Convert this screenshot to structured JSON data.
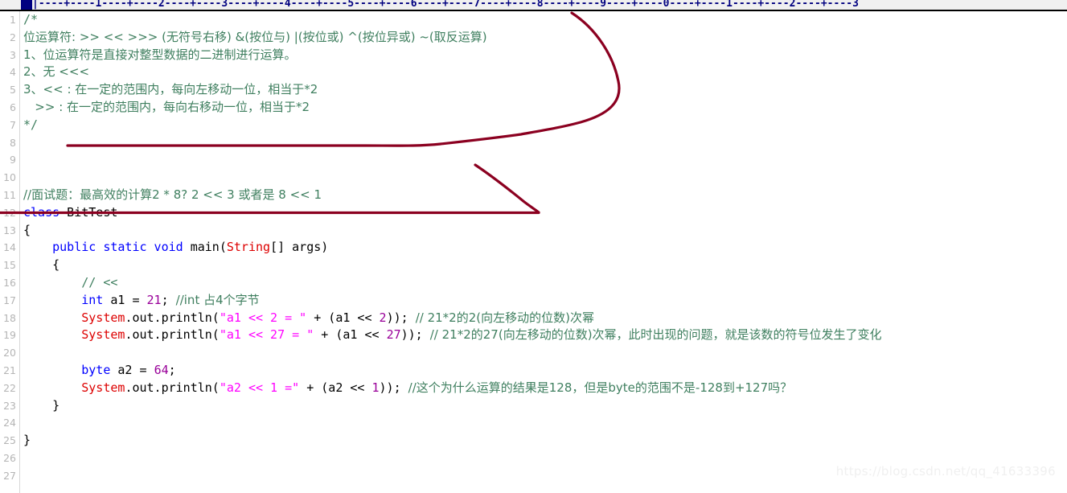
{
  "ruler": {
    "name": "column-ruler",
    "marks": "|----+----1----+----2----+----3----+----4----+----5----+----6----+----7----+----8----+----9----+----0----+----1----+----2----+----3",
    "caret_column": 1,
    "color": "#000080"
  },
  "gutter": {
    "line_numbers": [
      1,
      2,
      3,
      4,
      5,
      6,
      7,
      8,
      9,
      10,
      11,
      12,
      13,
      14,
      15,
      16,
      17,
      18,
      19,
      20,
      21,
      22,
      23,
      24,
      25,
      26,
      27
    ],
    "color": "#b5b5b5"
  },
  "colors": {
    "comment": "#3f7f5f",
    "keyword": "#0000ff",
    "type": "#dd0000",
    "string": "#ff00ff",
    "number": "#990099",
    "plain": "#000000",
    "annotation": "#8b0020",
    "ruler": "#000080",
    "watermark": "#f0f0f0"
  },
  "code": {
    "lines": [
      {
        "n": 1,
        "tokens": [
          {
            "t": "comment",
            "v": "/*"
          }
        ]
      },
      {
        "n": 2,
        "tokens": [
          {
            "t": "comment",
            "v": "位运算符: >> << >>> (无符号右移) &(按位与) |(按位或) ^(按位异或) ~(取反运算)"
          }
        ]
      },
      {
        "n": 3,
        "tokens": [
          {
            "t": "comment",
            "v": "1、位运算符是直接对整型数据的二进制进行运算。"
          }
        ]
      },
      {
        "n": 4,
        "tokens": [
          {
            "t": "comment",
            "v": "2、无 <<<"
          }
        ]
      },
      {
        "n": 5,
        "tokens": [
          {
            "t": "comment",
            "v": "3、<< : 在一定的范围内，每向左移动一位，相当于*2"
          }
        ]
      },
      {
        "n": 6,
        "tokens": [
          {
            "t": "comment",
            "v": "   >> : 在一定的范围内，每向右移动一位，相当于*2"
          }
        ]
      },
      {
        "n": 7,
        "tokens": [
          {
            "t": "comment",
            "v": "*/"
          }
        ]
      },
      {
        "n": 8,
        "tokens": []
      },
      {
        "n": 9,
        "tokens": []
      },
      {
        "n": 10,
        "tokens": []
      },
      {
        "n": 11,
        "tokens": [
          {
            "t": "comment",
            "v": "//面试题：最高效的计算2 * 8? 2 << 3 或者是 8 << 1"
          }
        ]
      },
      {
        "n": 12,
        "tokens": [
          {
            "t": "keyword",
            "v": "class"
          },
          {
            "t": "plain",
            "v": " BitTest"
          }
        ]
      },
      {
        "n": 13,
        "tokens": [
          {
            "t": "plain",
            "v": "{"
          }
        ]
      },
      {
        "n": 14,
        "tokens": [
          {
            "t": "plain",
            "v": "    "
          },
          {
            "t": "keyword",
            "v": "public static void"
          },
          {
            "t": "plain",
            "v": " main("
          },
          {
            "t": "type",
            "v": "String"
          },
          {
            "t": "plain",
            "v": "[] args)"
          }
        ]
      },
      {
        "n": 15,
        "tokens": [
          {
            "t": "plain",
            "v": "    {"
          }
        ]
      },
      {
        "n": 16,
        "tokens": [
          {
            "t": "plain",
            "v": "        "
          },
          {
            "t": "comment",
            "v": "// <<"
          }
        ]
      },
      {
        "n": 17,
        "tokens": [
          {
            "t": "plain",
            "v": "        "
          },
          {
            "t": "keyword",
            "v": "int"
          },
          {
            "t": "plain",
            "v": " a1 = "
          },
          {
            "t": "number",
            "v": "21"
          },
          {
            "t": "plain",
            "v": "; "
          },
          {
            "t": "comment",
            "v": "//int 占4个字节"
          }
        ]
      },
      {
        "n": 18,
        "tokens": [
          {
            "t": "plain",
            "v": "        "
          },
          {
            "t": "type",
            "v": "System"
          },
          {
            "t": "plain",
            "v": ".out.println("
          },
          {
            "t": "string",
            "v": "\"a1 << 2 = \""
          },
          {
            "t": "plain",
            "v": " + (a1 << "
          },
          {
            "t": "number",
            "v": "2"
          },
          {
            "t": "plain",
            "v": ")); "
          },
          {
            "t": "comment",
            "v": "// 21*2的2(向左移动的位数)次幂"
          }
        ]
      },
      {
        "n": 19,
        "tokens": [
          {
            "t": "plain",
            "v": "        "
          },
          {
            "t": "type",
            "v": "System"
          },
          {
            "t": "plain",
            "v": ".out.println("
          },
          {
            "t": "string",
            "v": "\"a1 << 27 = \""
          },
          {
            "t": "plain",
            "v": " + (a1 << "
          },
          {
            "t": "number",
            "v": "27"
          },
          {
            "t": "plain",
            "v": ")); "
          },
          {
            "t": "comment",
            "v": "// 21*2的27(向左移动的位数)次幂，此时出现的问题，就是该数的符号位发生了变化"
          }
        ]
      },
      {
        "n": 20,
        "tokens": []
      },
      {
        "n": 21,
        "tokens": [
          {
            "t": "plain",
            "v": "        "
          },
          {
            "t": "keyword",
            "v": "byte"
          },
          {
            "t": "plain",
            "v": " a2 = "
          },
          {
            "t": "number",
            "v": "64"
          },
          {
            "t": "plain",
            "v": ";"
          }
        ]
      },
      {
        "n": 22,
        "tokens": [
          {
            "t": "plain",
            "v": "        "
          },
          {
            "t": "type",
            "v": "System"
          },
          {
            "t": "plain",
            "v": ".out.println("
          },
          {
            "t": "string",
            "v": "\"a2 << 1 =\""
          },
          {
            "t": "plain",
            "v": " + (a2 << "
          },
          {
            "t": "number",
            "v": "1"
          },
          {
            "t": "plain",
            "v": ")); "
          },
          {
            "t": "comment",
            "v": "//这个为什么运算的结果是128，但是byte的范围不是-128到+127吗？"
          }
        ]
      },
      {
        "n": 23,
        "tokens": [
          {
            "t": "plain",
            "v": "    }"
          }
        ]
      },
      {
        "n": 24,
        "tokens": []
      },
      {
        "n": 25,
        "tokens": [
          {
            "t": "plain",
            "v": "}"
          }
        ]
      },
      {
        "n": 26,
        "tokens": []
      },
      {
        "n": 27,
        "tokens": []
      }
    ]
  },
  "annotations": {
    "stroke": "#8b0020",
    "shapes": [
      {
        "name": "hook-curve-upper",
        "desc": "large hand-drawn hook around comment block"
      },
      {
        "name": "underline-class-line",
        "desc": "horizontal strike-through over class BitTest"
      },
      {
        "name": "diagonal-pointer",
        "desc": "diagonal stroke pointing down to the class line"
      }
    ]
  },
  "watermark": {
    "text": "https://blog.csdn.net/qq_41633396"
  }
}
